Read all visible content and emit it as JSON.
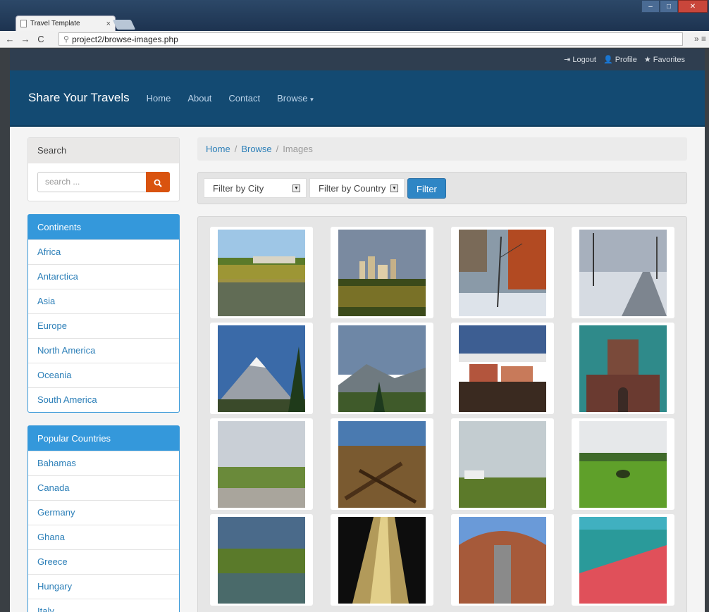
{
  "browser": {
    "tab_title": "Travel Template",
    "tab_close": "×",
    "url": "project2/browse-images.php",
    "nav_back": "←",
    "nav_forward": "→",
    "nav_reload": "C",
    "menu_glyph": "» ≡"
  },
  "topbar": {
    "logout": "Logout",
    "profile": "Profile",
    "favorites": "Favorites"
  },
  "nav": {
    "brand": "Share Your Travels",
    "home": "Home",
    "about": "About",
    "contact": "Contact",
    "browse": "Browse"
  },
  "search": {
    "heading": "Search",
    "placeholder": "search ..."
  },
  "continents": {
    "heading": "Continents",
    "items": [
      "Africa",
      "Antarctica",
      "Asia",
      "Europe",
      "North America",
      "Oceania",
      "South America"
    ]
  },
  "countries": {
    "heading": "Popular Countries",
    "items": [
      "Bahamas",
      "Canada",
      "Germany",
      "Ghana",
      "Greece",
      "Hungary",
      "Italy"
    ]
  },
  "breadcrumb": {
    "home": "Home",
    "browse": "Browse",
    "current": "Images",
    "separator": "/"
  },
  "filters": {
    "city": "Filter by City",
    "country": "Filter by Country",
    "button": "Filter"
  },
  "colors": {
    "accent_blue": "#3498db",
    "nav_blue": "#134a72",
    "search_orange": "#d9530f"
  }
}
